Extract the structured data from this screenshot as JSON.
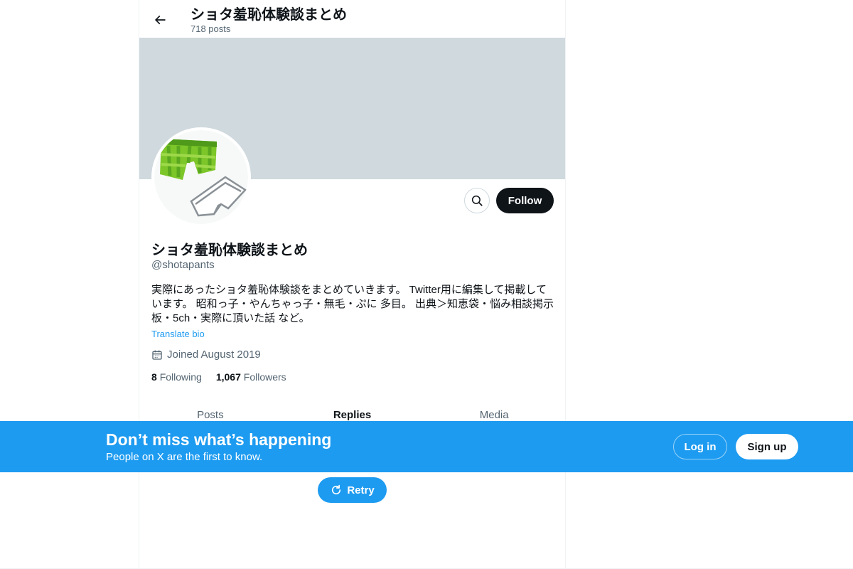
{
  "header": {
    "title": "ショタ羞恥体験談まとめ",
    "post_count": "718 posts"
  },
  "profile": {
    "name": "ショタ羞恥体験談まとめ",
    "handle": "@shotapants",
    "bio": "実際にあったショタ羞恥体験談をまとめていきます。 Twitter用に編集して掲載しています。 昭和っ子・やんちゃっ子・無毛・ぷに 多目。 出典＞知恵袋・悩み相談掲示板・5ch・実際に頂いた話 など。",
    "translate_label": "Translate bio",
    "joined": "Joined August 2019",
    "following_count": "8",
    "following_label": "Following",
    "followers_count": "1,067",
    "followers_label": "Followers"
  },
  "actions": {
    "follow_label": "Follow",
    "retry_label": "Retry"
  },
  "tabs": [
    {
      "label": "Posts"
    },
    {
      "label": "Replies"
    },
    {
      "label": "Media"
    }
  ],
  "promo": {
    "title": "Don’t miss what’s happening",
    "subtitle": "People on X are the first to know.",
    "login_label": "Log in",
    "signup_label": "Sign up"
  },
  "icons": {
    "back": "arrow-left-icon",
    "search": "search-icon",
    "calendar": "calendar-icon",
    "retry": "refresh-icon"
  },
  "colors": {
    "accent": "#1d9bf0",
    "banner": "#cfd9de",
    "text_primary": "#0f1419",
    "text_secondary": "#536471"
  }
}
